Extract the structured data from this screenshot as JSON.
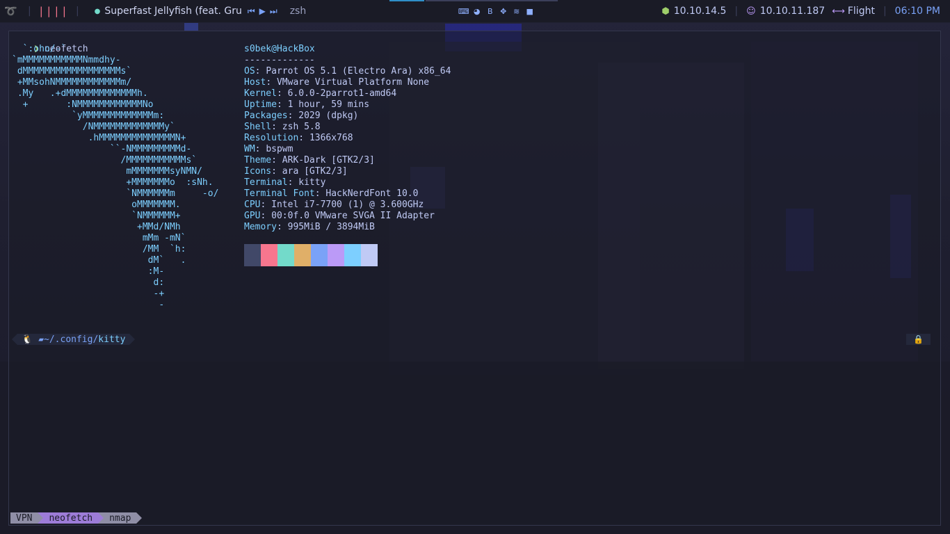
{
  "topbar": {
    "logo_icon": "parrot-icon",
    "workspaces": "||||",
    "spotify_icon": "spotify-icon",
    "song": "Superfast Jellyfish (feat. Gru",
    "controls": {
      "prev": "⏮",
      "play": "▶",
      "next": "⏭"
    },
    "window_title": "zsh",
    "tray_icons": [
      "terminal-icon",
      "firefox-icon",
      "burpsuite-icon",
      "paw-icon",
      "spotify-icon",
      "folder-icon"
    ],
    "tray_glyphs": [
      "⌨",
      "◕",
      "B",
      "✥",
      "≋",
      "■"
    ],
    "local_ip_icon": "cube-icon",
    "local_ip": "10.10.14.5",
    "target_icon": "target-icon",
    "target_ip": "10.10.11.187",
    "machine_icon": "arrow-icon",
    "machine_name": "Flight",
    "time": "06:10 PM"
  },
  "terminal": {
    "prompt_symbol": "❯",
    "command": "neofetch",
    "ascii_art": [
      "  `:oho/-`",
      "`mMMMMMMMMMMMNmmdhy-",
      " dMMMMMMMMMMMMMMMMMMs`",
      " +MMsohNMMMMMMMMMMMMm/",
      " .My   .+dMMMMMMMMMMMMMh.",
      "  +       :NMMMMMMMMMMMMNo",
      "           `yMMMMMMMMMMMMMm:",
      "             /NMMMMMMMMMMMMMy`",
      "              .hMMMMMMMMMMMMMMN+",
      "                  ``-NMMMMMMMMMd-",
      "                    /MMMMMMMMMMMs`",
      "                     mMMMMMMMsyNMN/",
      "                     +MMMMMMMo  :sNh.",
      "                     `NMMMMMMm     -o/",
      "                      oMMMMMMM.",
      "                      `NMMMMMM+",
      "                       +MMd/NMh",
      "                        mMm -mN`",
      "                        /MM  `h:",
      "                         dM`   .",
      "                         :M-",
      "                          d:",
      "                          -+",
      "                           -"
    ],
    "user_host": "s0bek@HackBox",
    "separator": "-------------",
    "info": [
      {
        "key": "OS",
        "value": "Parrot OS 5.1 (Electro Ara) x86_64"
      },
      {
        "key": "Host",
        "value": "VMware Virtual Platform None"
      },
      {
        "key": "Kernel",
        "value": "6.0.0-2parrot1-amd64"
      },
      {
        "key": "Uptime",
        "value": "1 hour, 59 mins"
      },
      {
        "key": "Packages",
        "value": "2029 (dpkg)"
      },
      {
        "key": "Shell",
        "value": "zsh 5.8"
      },
      {
        "key": "Resolution",
        "value": "1366x768"
      },
      {
        "key": "WM",
        "value": "bspwm"
      },
      {
        "key": "Theme",
        "value": "ARK-Dark [GTK2/3]"
      },
      {
        "key": "Icons",
        "value": "ara [GTK2/3]"
      },
      {
        "key": "Terminal",
        "value": "kitty"
      },
      {
        "key": "Terminal Font",
        "value": "HackNerdFont 10.0"
      },
      {
        "key": "CPU",
        "value": "Intel i7-7700 (1) @ 3.600GHz"
      },
      {
        "key": "GPU",
        "value": "00:0f.0 VMware SVGA II Adapter"
      },
      {
        "key": "Memory",
        "value": "995MiB / 3894MiB"
      }
    ],
    "color_swatches": [
      "#414868",
      "#f7768e",
      "#73daca",
      "#e0af68",
      "#7aa2f7",
      "#bb9af7",
      "#7dcfff",
      "#c0caf5"
    ],
    "prompt": {
      "os_icon": "linux-icon",
      "os_glyph": "🐧",
      "folder_icon": "folder-icon",
      "path_prefix": "~/.config/",
      "path_dir": "kitty",
      "lock_icon": "lock-icon"
    }
  },
  "tabs": [
    {
      "label": "VPN",
      "active": false
    },
    {
      "label": "neofetch",
      "active": true
    },
    {
      "label": "nmap",
      "active": false
    }
  ]
}
